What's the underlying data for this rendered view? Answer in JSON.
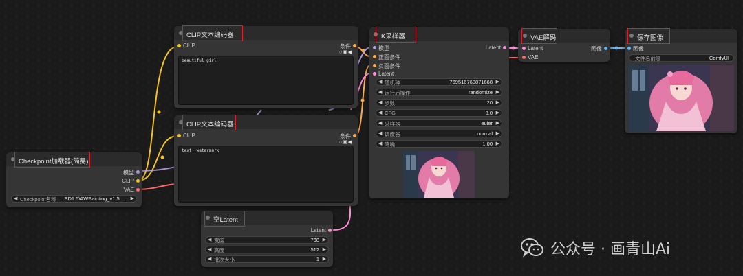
{
  "nodes": {
    "clip_encoder_1": {
      "title": "CLIP文本编码器",
      "input_clip": "CLIP",
      "output_label": "条件",
      "text": "beautiful girl"
    },
    "clip_encoder_2": {
      "title": "CLIP文本编码器",
      "input_clip": "CLIP",
      "output_label": "条件",
      "text": "text, watermark"
    },
    "checkpoint_loader": {
      "title": "Checkpoint加载器(简易)",
      "outputs": [
        "模型",
        "CLIP",
        "VAE"
      ],
      "widget_label": "Checkpoint名称",
      "widget_value": "SD1.5\\AWPainting_v1.5...."
    },
    "empty_latent": {
      "title": "空Latent",
      "output_label": "Latent",
      "widgets": [
        {
          "label": "宽度",
          "value": "768"
        },
        {
          "label": "高度",
          "value": "512"
        },
        {
          "label": "批次大小",
          "value": "1"
        }
      ]
    },
    "ksampler": {
      "title": "K采样器",
      "inputs": [
        "模型",
        "正面条件",
        "负面条件",
        "Latent"
      ],
      "output_label": "Latent",
      "widgets": [
        {
          "label": "随机种",
          "value": "769516760871668"
        },
        {
          "label": "运行后操作",
          "value": "randomize"
        },
        {
          "label": "步数",
          "value": "20"
        },
        {
          "label": "CFG",
          "value": "8.0"
        },
        {
          "label": "采样器",
          "value": "euler"
        },
        {
          "label": "调度器",
          "value": "normal"
        },
        {
          "label": "降噪",
          "value": "1.00"
        }
      ]
    },
    "vae_decode": {
      "title": "VAE解码",
      "inputs": [
        "Latent",
        "VAE"
      ],
      "output_label": "图像"
    },
    "save_image": {
      "title": "保存图像",
      "input_label": "图像",
      "widget_label": "文件名前缀",
      "widget_value": "ComfyUI"
    }
  },
  "icons": {
    "toggle": "circle-icon",
    "check": "checkbox-icon",
    "speaker": "speaker-icon"
  },
  "colors": {
    "clip": "#f5c518",
    "model": "#b39ddb",
    "conditioning": "#ffa94d",
    "latent": "#ff8fd8",
    "vae": "#ff6b6b",
    "image": "#64b5f6",
    "highlight": "#e11d2a"
  },
  "watermark": {
    "icon": "wechat-icon",
    "text": "公众号 · 画青山Ai"
  }
}
